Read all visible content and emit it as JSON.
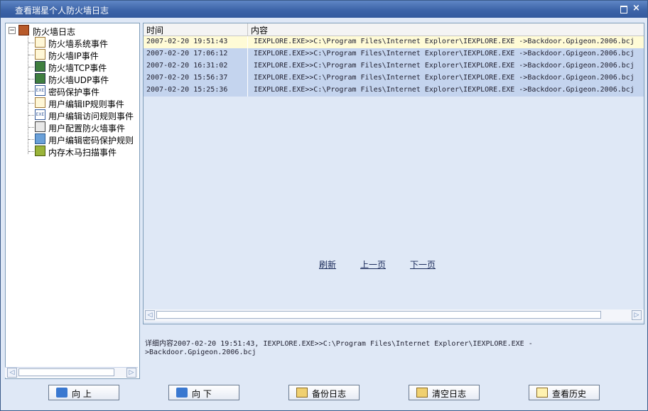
{
  "window": {
    "title": "查看瑞星个人防火墙日志",
    "max_symbol": "",
    "close_symbol": "×"
  },
  "tree": {
    "root": {
      "label": "防火墙日志",
      "expander": "−"
    },
    "items": [
      {
        "label": "防火墙系统事件",
        "icon": "document-icon"
      },
      {
        "label": "防火墙IP事件",
        "icon": "ip-document-icon"
      },
      {
        "label": "防火墙TCP事件",
        "icon": "computer-icon"
      },
      {
        "label": "防火墙UDP事件",
        "icon": "computer-icon"
      },
      {
        "label": "密码保护事件",
        "icon": "exe-icon"
      },
      {
        "label": "用户编辑IP规则事件",
        "icon": "ip-document-icon"
      },
      {
        "label": "用户编辑访问规则事件",
        "icon": "exe-icon"
      },
      {
        "label": "用户配置防火墙事件",
        "icon": "settings-icon"
      },
      {
        "label": "用户编辑密码保护规则",
        "icon": "user-icon"
      },
      {
        "label": "内存木马扫描事件",
        "icon": "scan-icon"
      }
    ]
  },
  "list": {
    "columns": {
      "time": "时间",
      "content": "内容"
    },
    "rows": [
      {
        "time": "2007-02-20 19:51:43",
        "content": "IEXPLORE.EXE>>C:\\Program Files\\Internet Explorer\\IEXPLORE.EXE ->Backdoor.Gpigeon.2006.bcj"
      },
      {
        "time": "2007-02-20 17:06:12",
        "content": "IEXPLORE.EXE>>C:\\Program Files\\Internet Explorer\\IEXPLORE.EXE ->Backdoor.Gpigeon.2006.bcj"
      },
      {
        "time": "2007-02-20 16:31:02",
        "content": "IEXPLORE.EXE>>C:\\Program Files\\Internet Explorer\\IEXPLORE.EXE ->Backdoor.Gpigeon.2006.bcj"
      },
      {
        "time": "2007-02-20 15:56:37",
        "content": "IEXPLORE.EXE>>C:\\Program Files\\Internet Explorer\\IEXPLORE.EXE ->Backdoor.Gpigeon.2006.bcj"
      },
      {
        "time": "2007-02-20 15:25:36",
        "content": "IEXPLORE.EXE>>C:\\Program Files\\Internet Explorer\\IEXPLORE.EXE ->Backdoor.Gpigeon.2006.bcj"
      }
    ],
    "pager": {
      "refresh": "刷新",
      "prev": "上一页",
      "next": "下一页"
    }
  },
  "detail": {
    "line1": "详细内容2007-02-20 19:51:43, IEXPLORE.EXE>>C:\\Program Files\\Internet Explorer\\IEXPLORE.EXE -",
    "line2": ">Backdoor.Gpigeon.2006.bcj"
  },
  "buttons": {
    "up": "向 上",
    "down": "向 下",
    "backup": "备份日志",
    "clear": "清空日志",
    "history": "查看历史"
  },
  "scroll": {
    "left_arrow": "◁",
    "right_arrow": "▷"
  },
  "colors": {
    "title_bar": "#3d64a8",
    "panel_bg": "#dfe8f6",
    "row_bg": "#c4d4ee",
    "selected_row_bg": "#fffbd6"
  }
}
